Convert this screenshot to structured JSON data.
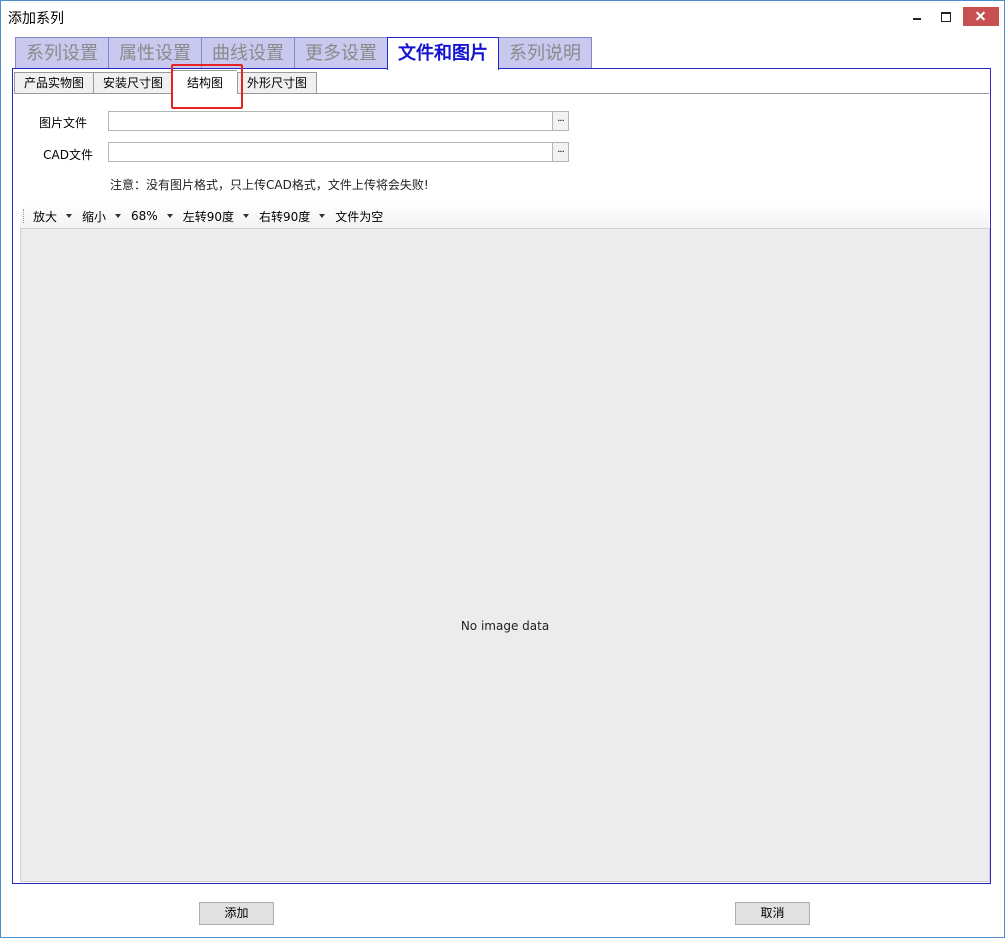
{
  "window": {
    "title": "添加系列"
  },
  "main_tabs": [
    {
      "label": "系列设置"
    },
    {
      "label": "属性设置"
    },
    {
      "label": "曲线设置"
    },
    {
      "label": "更多设置"
    },
    {
      "label": "文件和图片"
    },
    {
      "label": "系列说明"
    }
  ],
  "sub_tabs": [
    {
      "label": "产品实物图"
    },
    {
      "label": "安装尺寸图"
    },
    {
      "label": "结构图"
    },
    {
      "label": "外形尺寸图"
    }
  ],
  "form": {
    "image_file": {
      "label": "图片文件",
      "value": "",
      "browse": "···"
    },
    "cad_file": {
      "label": "CAD文件",
      "value": "",
      "browse": "···"
    },
    "note": "注意：没有图片格式，只上传CAD格式，文件上传将会失败!"
  },
  "toolbar": {
    "zoom_in": "放大",
    "zoom_out": "缩小",
    "zoom_level": "68%",
    "rotate_left": "左转90度",
    "rotate_right": "右转90度",
    "file_status": "文件为空"
  },
  "viewer": {
    "message": "No image data"
  },
  "buttons": {
    "add": "添加",
    "cancel": "取消"
  }
}
